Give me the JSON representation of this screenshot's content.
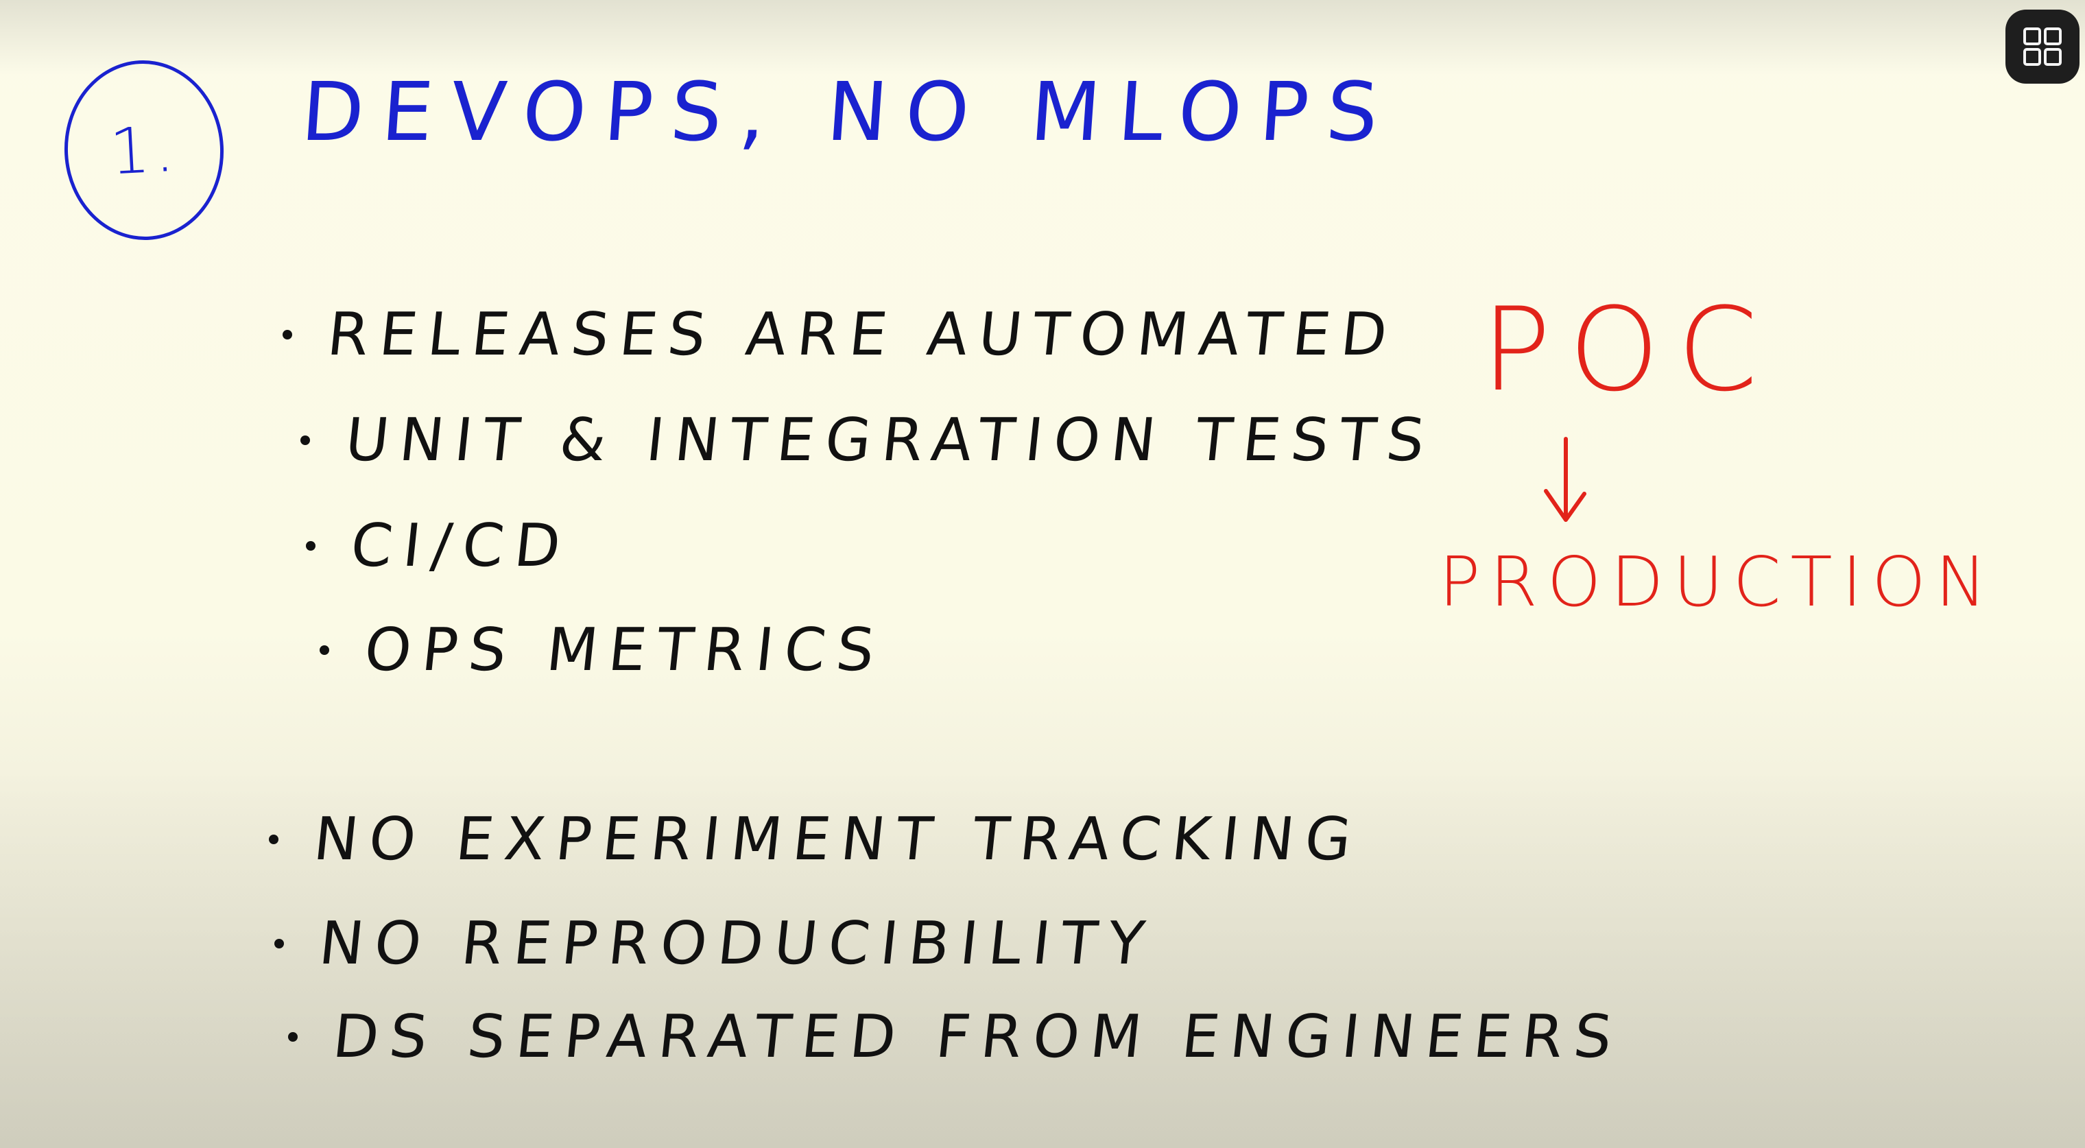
{
  "section": {
    "number": "1.",
    "heading": "DEVOPS, NO MLOPS"
  },
  "positives": [
    "RELEASES ARE AUTOMATED",
    "UNIT & INTEGRATION TESTS",
    "CI/CD",
    "OPS METRICS"
  ],
  "negatives": [
    "NO EXPERIMENT TRACKING",
    "NO REPRODUCIBILITY",
    "DS SEPARATED FROM ENGINEERS"
  ],
  "side_note": {
    "from": "POC",
    "to": "PRODUCTION"
  },
  "icons": {
    "grid_button": "grid-icon"
  },
  "colors": {
    "heading_ink": "#1a22cf",
    "body_ink": "#111111",
    "accent_ink": "#e2231a",
    "paper": "#fcfbe9",
    "grid_button_bg": "#1e1e1e"
  }
}
